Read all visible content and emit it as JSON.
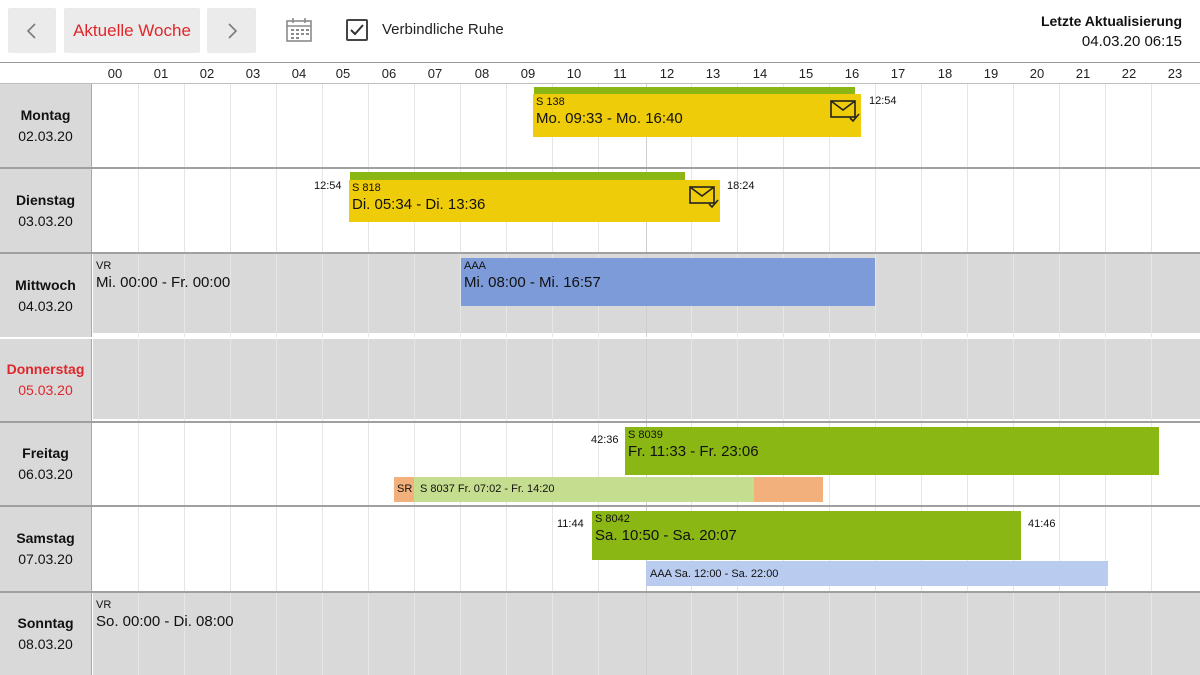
{
  "toolbar": {
    "prev_icon": "chevron-left-icon",
    "current_week_label": "Aktuelle Woche",
    "next_icon": "chevron-right-icon",
    "calendar_icon": "calendar-icon",
    "mandatory_rest_label": "Verbindliche Ruhe",
    "mandatory_rest_checked": true,
    "last_update_title": "Letzte Aktualisierung",
    "last_update_value": "04.03.20 06:15"
  },
  "colors": {
    "accent_red": "#e0262b",
    "yellow": "#eecc0a",
    "green": "#8bb714",
    "green_light": "#c5dd8e",
    "orange": "#f2b07c",
    "blue": "#7d9bd8",
    "blue_light": "#b9cbee",
    "gray": "#d9d9d9"
  },
  "hours": [
    "00",
    "01",
    "02",
    "03",
    "04",
    "05",
    "06",
    "07",
    "08",
    "09",
    "10",
    "11",
    "12",
    "13",
    "14",
    "15",
    "16",
    "17",
    "18",
    "19",
    "20",
    "21",
    "22",
    "23"
  ],
  "days": [
    {
      "name": "Montag",
      "date": "02.03.20",
      "blocks": {
        "main": {
          "code": "S 138",
          "time": "Mo. 09:33 - Mo. 16:40",
          "mail_icon": "mail-check-icon"
        },
        "right_number": "12:54"
      }
    },
    {
      "name": "Dienstag",
      "date": "03.03.20",
      "blocks": {
        "main": {
          "code": "S 818",
          "time": "Di. 05:34 - Di. 13:36",
          "mail_icon": "mail-check-icon"
        },
        "left_number": "12:54",
        "right_number": "18:24"
      }
    },
    {
      "name": "Mittwoch",
      "date": "04.03.20",
      "blocks": {
        "rest": {
          "code": "VR",
          "time": "Mi. 00:00 - Fr. 00:00"
        },
        "main": {
          "code": "AAA",
          "time": "Mi. 08:00 - Mi. 16:57"
        }
      }
    },
    {
      "name": "Donnerstag",
      "date": "05.03.20",
      "today": true
    },
    {
      "name": "Freitag",
      "date": "06.03.20",
      "blocks": {
        "main": {
          "code": "S 8039",
          "time": "Fr. 11:33 - Fr. 23:06"
        },
        "left_number": "42:36",
        "sub_code": "SR",
        "sub_text": "S 8037 Fr. 07:02 - Fr. 14:20"
      }
    },
    {
      "name": "Samstag",
      "date": "07.03.20",
      "blocks": {
        "main": {
          "code": "S 8042",
          "time": "Sa. 10:50 - Sa. 20:07"
        },
        "left_number": "11:44",
        "right_number": "41:46",
        "sub_text": "AAA Sa. 12:00 - Sa. 22:00"
      }
    },
    {
      "name": "Sonntag",
      "date": "08.03.20",
      "blocks": {
        "rest": {
          "code": "VR",
          "time": "So. 00:00 - Di. 08:00"
        }
      }
    }
  ]
}
